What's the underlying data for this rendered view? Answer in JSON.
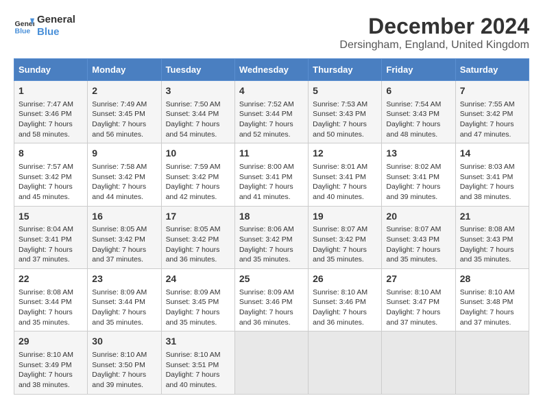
{
  "header": {
    "logo_line1": "General",
    "logo_line2": "Blue",
    "month": "December 2024",
    "location": "Dersingham, England, United Kingdom"
  },
  "days_of_week": [
    "Sunday",
    "Monday",
    "Tuesday",
    "Wednesday",
    "Thursday",
    "Friday",
    "Saturday"
  ],
  "weeks": [
    [
      {
        "day": "1",
        "info": "Sunrise: 7:47 AM\nSunset: 3:46 PM\nDaylight: 7 hours\nand 58 minutes."
      },
      {
        "day": "2",
        "info": "Sunrise: 7:49 AM\nSunset: 3:45 PM\nDaylight: 7 hours\nand 56 minutes."
      },
      {
        "day": "3",
        "info": "Sunrise: 7:50 AM\nSunset: 3:44 PM\nDaylight: 7 hours\nand 54 minutes."
      },
      {
        "day": "4",
        "info": "Sunrise: 7:52 AM\nSunset: 3:44 PM\nDaylight: 7 hours\nand 52 minutes."
      },
      {
        "day": "5",
        "info": "Sunrise: 7:53 AM\nSunset: 3:43 PM\nDaylight: 7 hours\nand 50 minutes."
      },
      {
        "day": "6",
        "info": "Sunrise: 7:54 AM\nSunset: 3:43 PM\nDaylight: 7 hours\nand 48 minutes."
      },
      {
        "day": "7",
        "info": "Sunrise: 7:55 AM\nSunset: 3:42 PM\nDaylight: 7 hours\nand 47 minutes."
      }
    ],
    [
      {
        "day": "8",
        "info": "Sunrise: 7:57 AM\nSunset: 3:42 PM\nDaylight: 7 hours\nand 45 minutes."
      },
      {
        "day": "9",
        "info": "Sunrise: 7:58 AM\nSunset: 3:42 PM\nDaylight: 7 hours\nand 44 minutes."
      },
      {
        "day": "10",
        "info": "Sunrise: 7:59 AM\nSunset: 3:42 PM\nDaylight: 7 hours\nand 42 minutes."
      },
      {
        "day": "11",
        "info": "Sunrise: 8:00 AM\nSunset: 3:41 PM\nDaylight: 7 hours\nand 41 minutes."
      },
      {
        "day": "12",
        "info": "Sunrise: 8:01 AM\nSunset: 3:41 PM\nDaylight: 7 hours\nand 40 minutes."
      },
      {
        "day": "13",
        "info": "Sunrise: 8:02 AM\nSunset: 3:41 PM\nDaylight: 7 hours\nand 39 minutes."
      },
      {
        "day": "14",
        "info": "Sunrise: 8:03 AM\nSunset: 3:41 PM\nDaylight: 7 hours\nand 38 minutes."
      }
    ],
    [
      {
        "day": "15",
        "info": "Sunrise: 8:04 AM\nSunset: 3:41 PM\nDaylight: 7 hours\nand 37 minutes."
      },
      {
        "day": "16",
        "info": "Sunrise: 8:05 AM\nSunset: 3:42 PM\nDaylight: 7 hours\nand 37 minutes."
      },
      {
        "day": "17",
        "info": "Sunrise: 8:05 AM\nSunset: 3:42 PM\nDaylight: 7 hours\nand 36 minutes."
      },
      {
        "day": "18",
        "info": "Sunrise: 8:06 AM\nSunset: 3:42 PM\nDaylight: 7 hours\nand 35 minutes."
      },
      {
        "day": "19",
        "info": "Sunrise: 8:07 AM\nSunset: 3:42 PM\nDaylight: 7 hours\nand 35 minutes."
      },
      {
        "day": "20",
        "info": "Sunrise: 8:07 AM\nSunset: 3:43 PM\nDaylight: 7 hours\nand 35 minutes."
      },
      {
        "day": "21",
        "info": "Sunrise: 8:08 AM\nSunset: 3:43 PM\nDaylight: 7 hours\nand 35 minutes."
      }
    ],
    [
      {
        "day": "22",
        "info": "Sunrise: 8:08 AM\nSunset: 3:44 PM\nDaylight: 7 hours\nand 35 minutes."
      },
      {
        "day": "23",
        "info": "Sunrise: 8:09 AM\nSunset: 3:44 PM\nDaylight: 7 hours\nand 35 minutes."
      },
      {
        "day": "24",
        "info": "Sunrise: 8:09 AM\nSunset: 3:45 PM\nDaylight: 7 hours\nand 35 minutes."
      },
      {
        "day": "25",
        "info": "Sunrise: 8:09 AM\nSunset: 3:46 PM\nDaylight: 7 hours\nand 36 minutes."
      },
      {
        "day": "26",
        "info": "Sunrise: 8:10 AM\nSunset: 3:46 PM\nDaylight: 7 hours\nand 36 minutes."
      },
      {
        "day": "27",
        "info": "Sunrise: 8:10 AM\nSunset: 3:47 PM\nDaylight: 7 hours\nand 37 minutes."
      },
      {
        "day": "28",
        "info": "Sunrise: 8:10 AM\nSunset: 3:48 PM\nDaylight: 7 hours\nand 37 minutes."
      }
    ],
    [
      {
        "day": "29",
        "info": "Sunrise: 8:10 AM\nSunset: 3:49 PM\nDaylight: 7 hours\nand 38 minutes."
      },
      {
        "day": "30",
        "info": "Sunrise: 8:10 AM\nSunset: 3:50 PM\nDaylight: 7 hours\nand 39 minutes."
      },
      {
        "day": "31",
        "info": "Sunrise: 8:10 AM\nSunset: 3:51 PM\nDaylight: 7 hours\nand 40 minutes."
      },
      {
        "day": "",
        "info": ""
      },
      {
        "day": "",
        "info": ""
      },
      {
        "day": "",
        "info": ""
      },
      {
        "day": "",
        "info": ""
      }
    ]
  ]
}
